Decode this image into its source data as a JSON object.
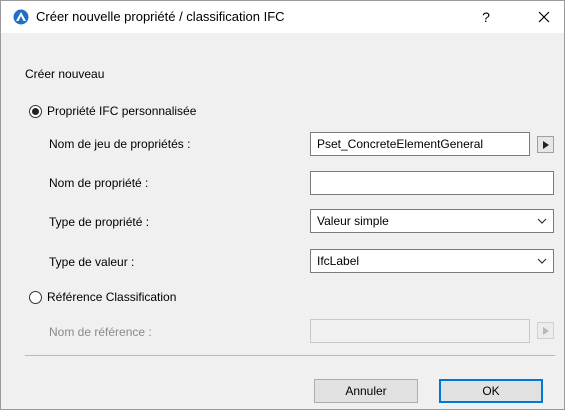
{
  "window": {
    "title": "Créer nouvelle propriété / classification IFC",
    "help_label": "?",
    "close_label": "✕"
  },
  "section": {
    "label": "Créer nouveau"
  },
  "custom_property": {
    "radio_label": "Propriété IFC personnalisée",
    "selected": true,
    "pset_label": "Nom de jeu de propriétés :",
    "pset_value": "Pset_ConcreteElementGeneral",
    "property_name_label": "Nom de propriété :",
    "property_name_value": "",
    "property_type_label": "Type de propriété :",
    "property_type_value": "Valeur simple",
    "value_type_label": "Type de valeur :",
    "value_type_value": "IfcLabel"
  },
  "classification": {
    "radio_label": "Référence Classification",
    "selected": false,
    "reference_name_label": "Nom de référence :",
    "reference_name_value": ""
  },
  "buttons": {
    "cancel_label": "Annuler",
    "ok_label": "OK"
  },
  "colors": {
    "accent": "#0078d7",
    "dialog_bg": "#f0f0f0"
  }
}
